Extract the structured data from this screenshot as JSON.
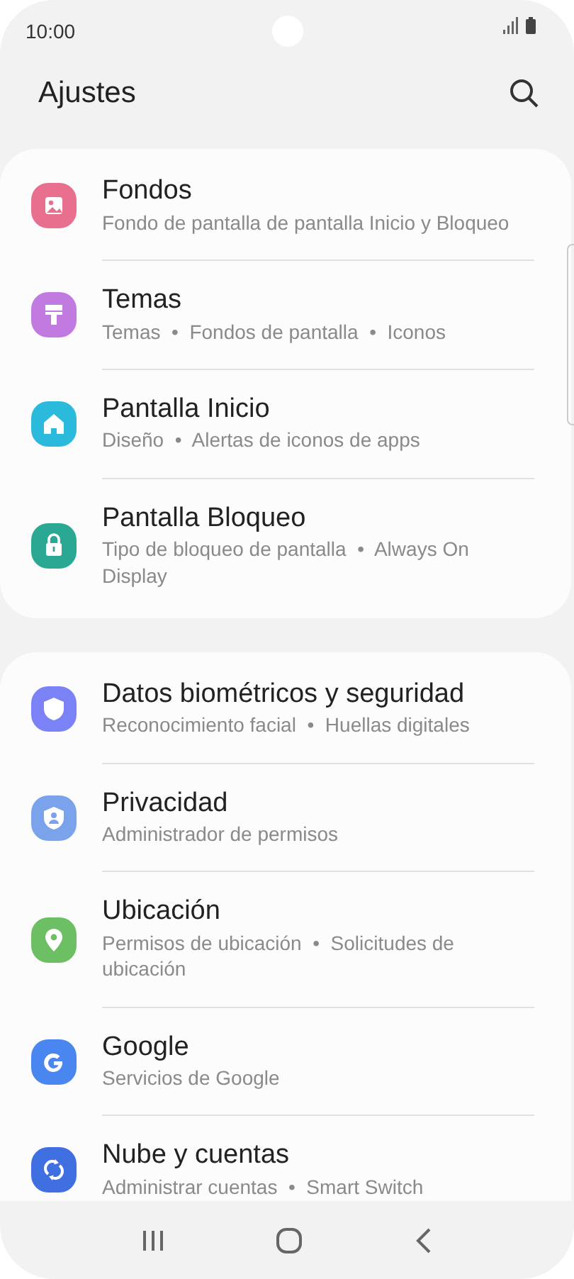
{
  "status_bar": {
    "time": "10:00"
  },
  "header": {
    "title": "Ajustes"
  },
  "groups": [
    {
      "items": [
        {
          "kind": "picture",
          "color": "#e86f8e",
          "title": "Fondos",
          "subtitle": "Fondo de pantalla de pantalla Inicio y Bloqueo"
        },
        {
          "kind": "brush",
          "color": "#c07ae0",
          "title": "Temas",
          "subtitle": "Temas  •  Fondos de pantalla  •  Iconos"
        },
        {
          "kind": "home",
          "color": "#2bbadb",
          "title": "Pantalla Inicio",
          "subtitle": "Diseño  •  Alertas de iconos de apps"
        },
        {
          "kind": "lock",
          "color": "#2aa894",
          "title": "Pantalla Bloqueo",
          "subtitle": "Tipo de bloqueo de pantalla  •  Always On Display"
        }
      ]
    },
    {
      "items": [
        {
          "kind": "shield",
          "color": "#7a82f5",
          "title": "Datos biométricos y seguridad",
          "subtitle": "Reconocimiento facial  •  Huellas digitales"
        },
        {
          "kind": "privacy",
          "color": "#7aa3ec",
          "title": "Privacidad",
          "subtitle": "Administrador de permisos"
        },
        {
          "kind": "pin",
          "color": "#6cbf62",
          "title": "Ubicación",
          "subtitle": "Permisos de ubicación  •  Solicitudes de ubicación"
        },
        {
          "kind": "google",
          "color": "#4a86f0",
          "title": "Google",
          "subtitle": "Servicios de Google"
        },
        {
          "kind": "sync",
          "color": "#3f6fe0",
          "title": "Nube y cuentas",
          "subtitle": "Administrar cuentas  •  Smart Switch"
        }
      ]
    }
  ]
}
